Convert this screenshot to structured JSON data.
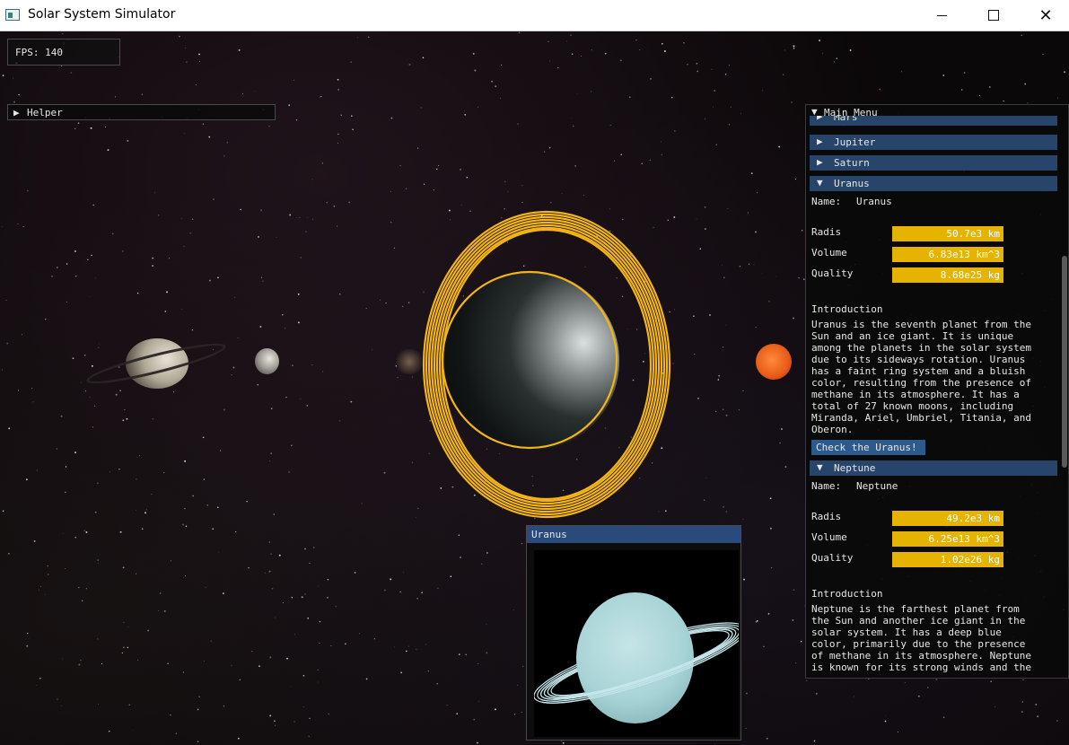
{
  "window": {
    "title": "Solar System Simulator",
    "min_label": "",
    "max_label": "",
    "close_label": "✕"
  },
  "fps": {
    "label": "FPS: 140"
  },
  "helper": {
    "label": "Helper",
    "arrow": "▶"
  },
  "main_menu": {
    "title": "Main Menu",
    "arrow": "▼",
    "collapsed": [
      {
        "label": "Mars",
        "arrow": "▶"
      },
      {
        "label": "Jupiter",
        "arrow": "▶"
      },
      {
        "label": "Saturn",
        "arrow": "▶"
      }
    ],
    "uranus": {
      "header": "Uranus",
      "arrow": "▼",
      "name_label": "Name:",
      "name_value": "Uranus",
      "radis_label": "Radis",
      "radis_value": "50.7e3 km",
      "volume_label": "Volume",
      "volume_value": "6.83e13 km^3",
      "quality_label": "Quality",
      "quality_value": "8.68e25 kg",
      "intro_label": "Introduction",
      "intro_lines": [
        "Uranus is the seventh planet from the",
        "Sun and an ice giant. It is unique",
        "among the planets in the solar system",
        "due to its sideways rotation. Uranus",
        "has a faint ring system and a bluish",
        "color, resulting from the presence of",
        "methane in its atmosphere. It has a",
        "total of 27 known moons, including",
        "Miranda, Ariel, Umbriel, Titania, and",
        "Oberon."
      ],
      "check_button": "Check the Uranus!"
    },
    "neptune": {
      "header": "Neptune",
      "arrow": "▼",
      "name_label": "Name:",
      "name_value": "Neptune",
      "radis_label": "Radis",
      "radis_value": "49.2e3 km",
      "volume_label": "Volume",
      "volume_value": "6.25e13 km^3",
      "quality_label": "Quality",
      "quality_value": "1.02e26 kg",
      "intro_label": "Introduction",
      "intro_lines": [
        "Neptune is the farthest planet from",
        "the Sun and another ice giant in the",
        "solar system. It has a deep blue",
        "color, primarily due to the presence",
        "of methane in its atmosphere. Neptune",
        "is known for its strong winds and the"
      ]
    }
  },
  "uranus_window": {
    "title": "Uranus"
  },
  "colors": {
    "accent": "#e6b400",
    "header_bg": "#27446a",
    "button_bg": "#2d5a8c",
    "titlebar_bg": "#294a7a",
    "orbit": "#f2b416",
    "uranus_ring": "#c6e6ea"
  }
}
